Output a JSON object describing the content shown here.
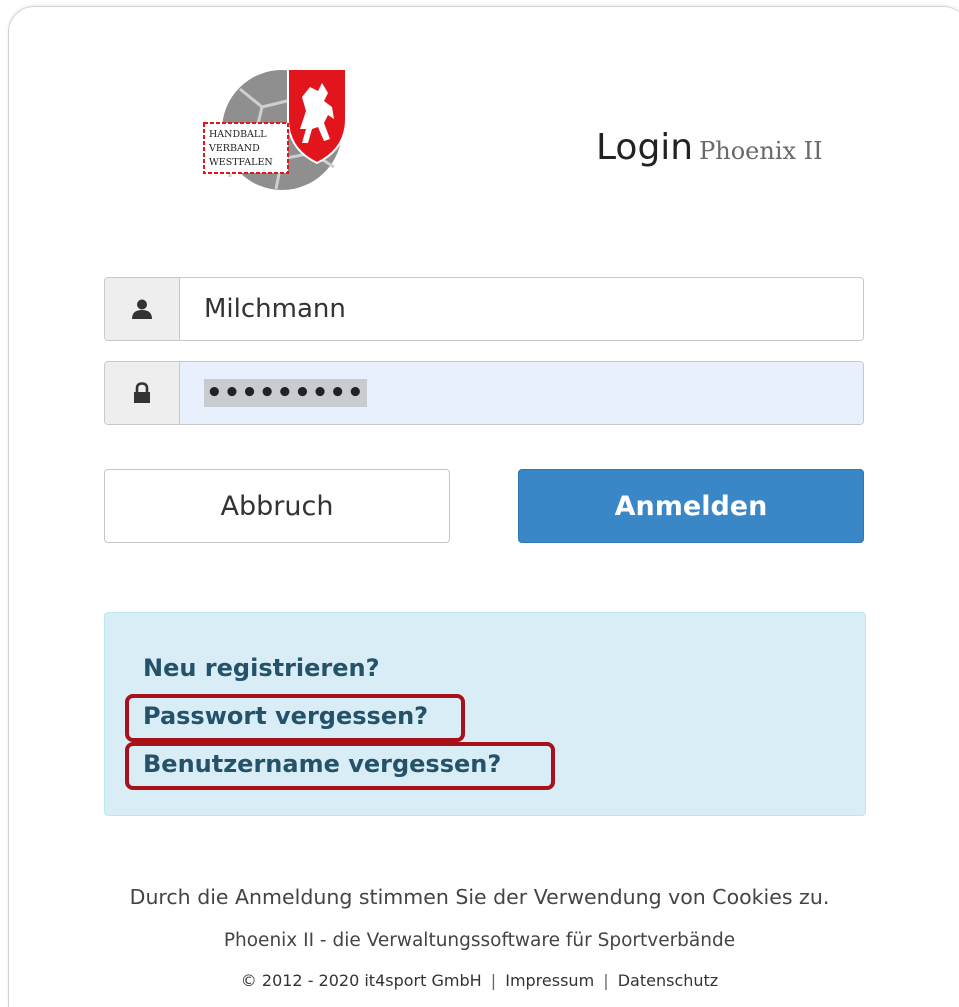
{
  "logo": {
    "lines": [
      "HANDBALL",
      "VERBAND",
      "WESTFALEN"
    ],
    "colors": {
      "red": "#e2141c",
      "ball": "#8f8f8f"
    }
  },
  "header": {
    "title": "Login",
    "subtitle": "Phoenix II"
  },
  "form": {
    "username": {
      "icon": "user-icon",
      "value": "Milchmann"
    },
    "password": {
      "icon": "lock-icon",
      "masked": "•••••••••"
    }
  },
  "buttons": {
    "cancel": "Abbruch",
    "login": "Anmelden"
  },
  "links": {
    "register": "Neu registrieren?",
    "forgot_password": "Passwort vergessen?",
    "forgot_username": "Benutzername vergessen?"
  },
  "footer": {
    "cookies": "Durch die Anmeldung stimmen Sie der Verwendung von Cookies zu.",
    "tagline": "Phoenix II - die Verwaltungssoftware für Sportverbände",
    "copyright": "© 2012 - 2020 it4sport GmbH",
    "separator": "|",
    "impressum": "Impressum",
    "datenschutz": "Datenschutz"
  },
  "colors": {
    "primary": "#3a87c8",
    "info_bg": "#d9edf7",
    "link": "#245269",
    "highlight": "#a8101a",
    "autofill": "#e8f0fe"
  }
}
